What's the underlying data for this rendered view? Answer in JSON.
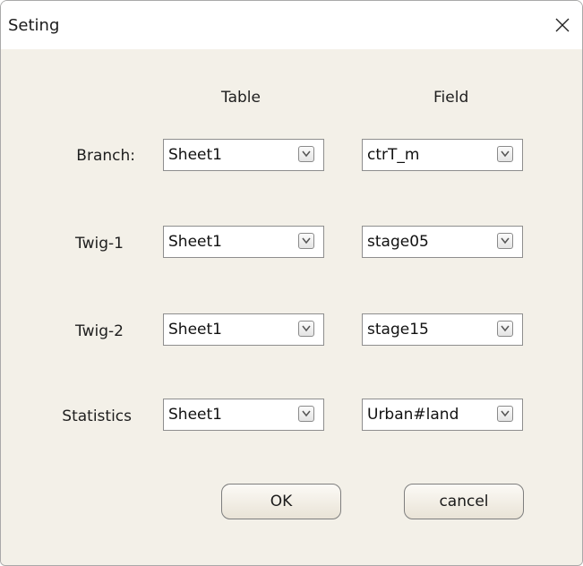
{
  "dialog": {
    "title": "Seting",
    "close_icon": "close-icon"
  },
  "columns": {
    "table": "Table",
    "field": "Field"
  },
  "rows": [
    {
      "label": "Branch:",
      "table": "Sheet1",
      "field": "ctrT_m"
    },
    {
      "label": "Twig-1",
      "table": "Sheet1",
      "field": "stage05"
    },
    {
      "label": "Twig-2",
      "table": "Sheet1",
      "field": "stage15"
    },
    {
      "label": "Statistics",
      "table": "Sheet1",
      "field": "Urban#land"
    }
  ],
  "buttons": {
    "ok": "OK",
    "cancel": "cancel"
  }
}
